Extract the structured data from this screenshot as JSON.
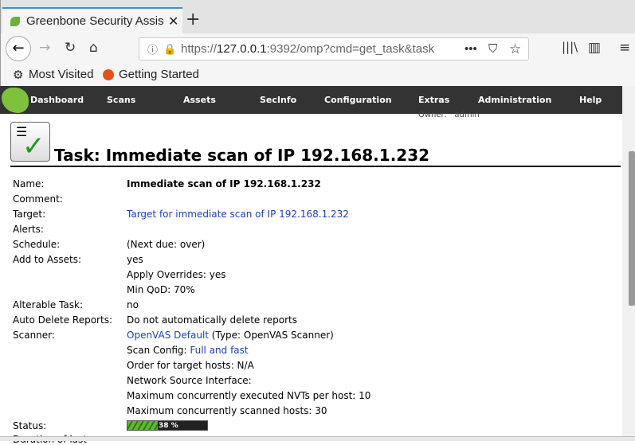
{
  "browser": {
    "tab_title": "Greenbone Security Assistant",
    "url_prefix": "https://",
    "url_host": "127.0.0.1",
    "url_rest": ":9392/omp?cmd=get_task&task",
    "bookmarks": [
      "Most Visited",
      "Getting Started"
    ]
  },
  "menu": [
    "Dashboard",
    "Scans",
    "Assets",
    "SecInfo",
    "Configuration",
    "Extras",
    "Administration",
    "Help"
  ],
  "owner_label": "Owner:",
  "owner": "admin",
  "title": "Task: Immediate scan of IP 192.168.1.232",
  "rows": [
    {
      "label": "Name:",
      "value": "Immediate scan of IP 192.168.1.232"
    },
    {
      "label": "Comment:",
      "value": ""
    },
    {
      "label": "Target:",
      "link": "Target for immediate scan of IP 192.168.1.232"
    },
    {
      "label": "Alerts:",
      "value": ""
    },
    {
      "label": "Schedule:",
      "value": "(Next due: over)"
    },
    {
      "label": "Add to Assets:",
      "value": "yes"
    },
    {
      "label": "",
      "value": "Apply Overrides: yes"
    },
    {
      "label": "",
      "value": "Min QoD: 70%"
    },
    {
      "label": "Alterable Task:",
      "value": "no"
    },
    {
      "label": "Auto Delete Reports:",
      "value": "Do not automatically delete reports"
    },
    {
      "label": "Scanner:",
      "link": "OpenVAS Default",
      "suffix": " (Type: OpenVAS Scanner)"
    },
    {
      "label": "",
      "prefix": "Scan Config: ",
      "link": "Full and fast"
    },
    {
      "label": "",
      "value": "Order for target hosts: N/A"
    },
    {
      "label": "",
      "value": "Network Source Interface:"
    },
    {
      "label": "",
      "value": "Maximum concurrently executed NVTs per host: 10"
    },
    {
      "label": "",
      "value": "Maximum concurrently scanned hosts: 30"
    }
  ],
  "status": {
    "label": "Status:",
    "progress_percent": 38,
    "text": "38 %"
  },
  "next_label": "Duration of last"
}
